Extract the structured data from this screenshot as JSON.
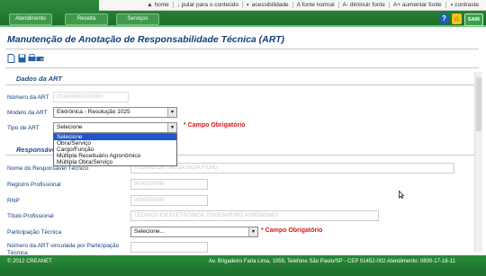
{
  "nav": {
    "items": [
      "Atendimento",
      "Receita",
      "Serviços"
    ],
    "util_links": [
      "▲ home",
      "↓ pular para o conteúdo",
      "◐ acessibilidade",
      "A fonte normal",
      "A- diminuir fonte",
      "A+ aumentar fonte",
      "◑ contraste"
    ],
    "icons": [
      "?",
      "⌂",
      "SAIR"
    ]
  },
  "page": {
    "title": "Manutenção de Anotação de Responsabilidade Técnica (ART)"
  },
  "sections": {
    "dados": "Dados da ART",
    "responsavel": "Responsável"
  },
  "form": {
    "numero": {
      "label": "Número da ART",
      "value": "2014/00000000000"
    },
    "modelo": {
      "label": "Modelo da ART",
      "value": "Eletrônica - Resolução 1025"
    },
    "tipo": {
      "label": "Tipo de ART",
      "value": "Selecione",
      "required": "Campo Obrigatório",
      "options": [
        "Selecione",
        "Obra/Serviço",
        "Cargo/Função",
        "Múltipla Receituário Agronômico",
        "Múltipla Obra/Serviço"
      ]
    },
    "nome": {
      "label": "Nome do Responsável Técnico",
      "value": "FULANO DE TAL DA SILVA FILHO"
    },
    "registro": {
      "label": "Registro Profissional",
      "value": "0000000000"
    },
    "rnp": {
      "label": "RNP",
      "value": "0000000000"
    },
    "titulo": {
      "label": "Título Profissional",
      "value": "TÉCNICO EM ELETRÔNICA, ENGENHEIRO AGRÔNOMO"
    },
    "participacao": {
      "label": "Participação Técnica",
      "value": "Selecione...",
      "required": "Campo Obrigatório"
    },
    "vinculada": {
      "label": "Número da ART vinculada por Participação Técnica",
      "value": ""
    }
  },
  "footer": {
    "left": "© 2012 CREANET",
    "right": "Av. Brigadeiro Faria Lima, 1059, Telefone São Paulo/SP - CEP 01452-002 Atendimento: 0800-17-18-11"
  },
  "colors": {
    "brand": "#1d6f2b",
    "title": "#123f7a",
    "required": "#d21a1a",
    "highlight": "#1f57c9"
  }
}
